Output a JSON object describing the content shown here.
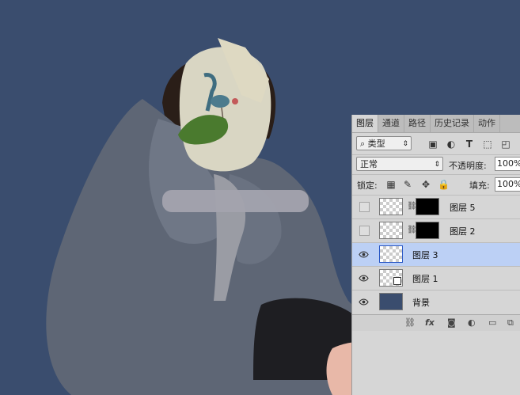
{
  "panel": {
    "tabs": [
      "图层",
      "通道",
      "路径",
      "历史记录",
      "动作"
    ],
    "filter": {
      "icon": "search-icon",
      "label": "类型"
    },
    "blend_mode": "正常",
    "opacity_label": "不透明度:",
    "opacity_value": "100%",
    "lock_label": "锁定:",
    "fill_label": "填充:",
    "fill_value": "100%",
    "layers": [
      {
        "name": "图层 5",
        "visible": false,
        "has_mask": true,
        "selected": false
      },
      {
        "name": "图层 2",
        "visible": false,
        "has_mask": true,
        "selected": false
      },
      {
        "name": "图层 3",
        "visible": true,
        "has_mask": false,
        "selected": true
      },
      {
        "name": "图层 1",
        "visible": true,
        "has_mask": false,
        "selected": false
      },
      {
        "name": "背景",
        "visible": true,
        "has_mask": false,
        "selected": false
      }
    ],
    "footer_icons": [
      "link-icon",
      "fx-icon",
      "mask-icon",
      "adjustment-icon",
      "folder-icon",
      "new-layer-icon"
    ]
  },
  "colors": {
    "canvas_bg": "#3a4d6e",
    "panel_bg": "#d6d6d6",
    "selected_row": "#bcd0f5",
    "background_thumb": "#3a4d6e"
  }
}
